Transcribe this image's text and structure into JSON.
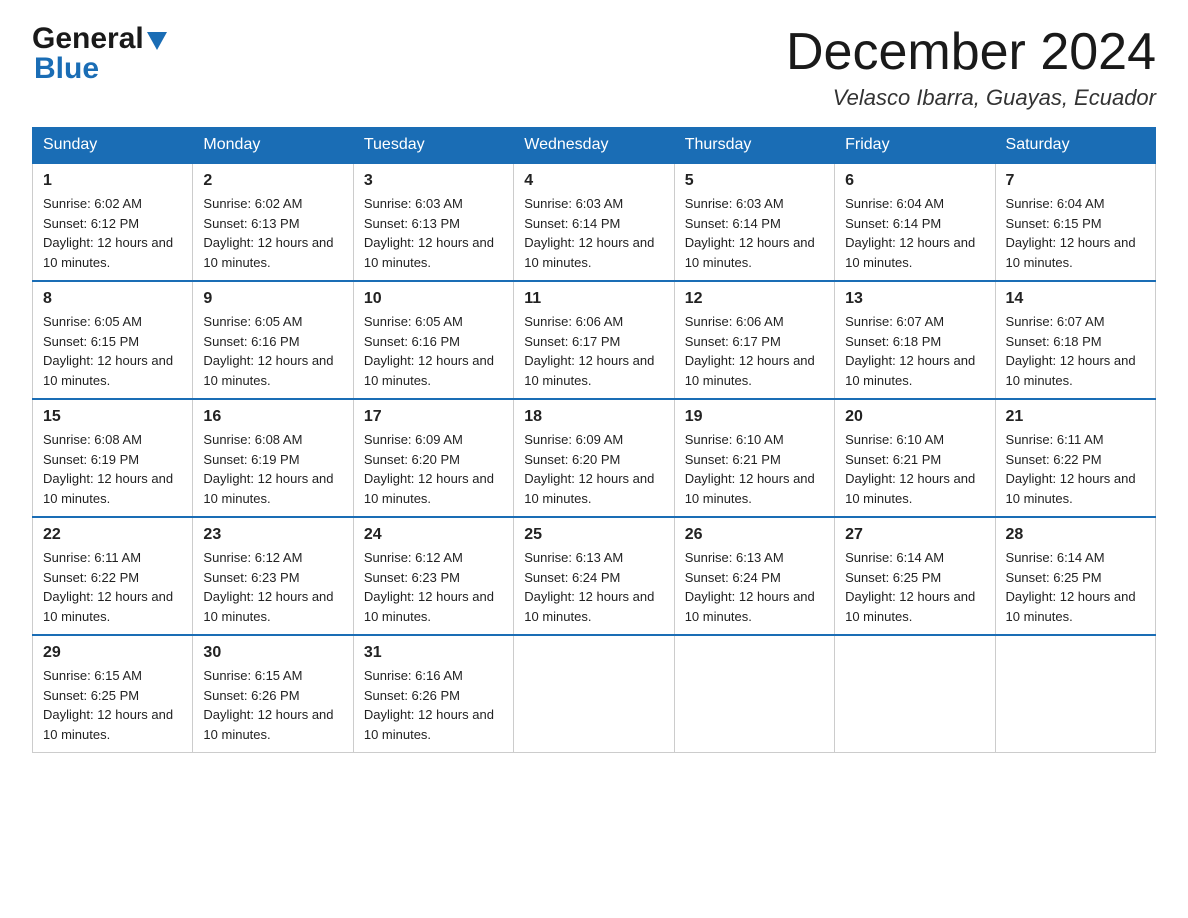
{
  "header": {
    "logo": {
      "general": "General",
      "blue": "Blue"
    },
    "title": "December 2024",
    "location": "Velasco Ibarra, Guayas, Ecuador"
  },
  "calendar": {
    "weekdays": [
      "Sunday",
      "Monday",
      "Tuesday",
      "Wednesday",
      "Thursday",
      "Friday",
      "Saturday"
    ],
    "weeks": [
      [
        {
          "day": "1",
          "sunrise": "Sunrise: 6:02 AM",
          "sunset": "Sunset: 6:12 PM",
          "daylight": "Daylight: 12 hours and 10 minutes."
        },
        {
          "day": "2",
          "sunrise": "Sunrise: 6:02 AM",
          "sunset": "Sunset: 6:13 PM",
          "daylight": "Daylight: 12 hours and 10 minutes."
        },
        {
          "day": "3",
          "sunrise": "Sunrise: 6:03 AM",
          "sunset": "Sunset: 6:13 PM",
          "daylight": "Daylight: 12 hours and 10 minutes."
        },
        {
          "day": "4",
          "sunrise": "Sunrise: 6:03 AM",
          "sunset": "Sunset: 6:14 PM",
          "daylight": "Daylight: 12 hours and 10 minutes."
        },
        {
          "day": "5",
          "sunrise": "Sunrise: 6:03 AM",
          "sunset": "Sunset: 6:14 PM",
          "daylight": "Daylight: 12 hours and 10 minutes."
        },
        {
          "day": "6",
          "sunrise": "Sunrise: 6:04 AM",
          "sunset": "Sunset: 6:14 PM",
          "daylight": "Daylight: 12 hours and 10 minutes."
        },
        {
          "day": "7",
          "sunrise": "Sunrise: 6:04 AM",
          "sunset": "Sunset: 6:15 PM",
          "daylight": "Daylight: 12 hours and 10 minutes."
        }
      ],
      [
        {
          "day": "8",
          "sunrise": "Sunrise: 6:05 AM",
          "sunset": "Sunset: 6:15 PM",
          "daylight": "Daylight: 12 hours and 10 minutes."
        },
        {
          "day": "9",
          "sunrise": "Sunrise: 6:05 AM",
          "sunset": "Sunset: 6:16 PM",
          "daylight": "Daylight: 12 hours and 10 minutes."
        },
        {
          "day": "10",
          "sunrise": "Sunrise: 6:05 AM",
          "sunset": "Sunset: 6:16 PM",
          "daylight": "Daylight: 12 hours and 10 minutes."
        },
        {
          "day": "11",
          "sunrise": "Sunrise: 6:06 AM",
          "sunset": "Sunset: 6:17 PM",
          "daylight": "Daylight: 12 hours and 10 minutes."
        },
        {
          "day": "12",
          "sunrise": "Sunrise: 6:06 AM",
          "sunset": "Sunset: 6:17 PM",
          "daylight": "Daylight: 12 hours and 10 minutes."
        },
        {
          "day": "13",
          "sunrise": "Sunrise: 6:07 AM",
          "sunset": "Sunset: 6:18 PM",
          "daylight": "Daylight: 12 hours and 10 minutes."
        },
        {
          "day": "14",
          "sunrise": "Sunrise: 6:07 AM",
          "sunset": "Sunset: 6:18 PM",
          "daylight": "Daylight: 12 hours and 10 minutes."
        }
      ],
      [
        {
          "day": "15",
          "sunrise": "Sunrise: 6:08 AM",
          "sunset": "Sunset: 6:19 PM",
          "daylight": "Daylight: 12 hours and 10 minutes."
        },
        {
          "day": "16",
          "sunrise": "Sunrise: 6:08 AM",
          "sunset": "Sunset: 6:19 PM",
          "daylight": "Daylight: 12 hours and 10 minutes."
        },
        {
          "day": "17",
          "sunrise": "Sunrise: 6:09 AM",
          "sunset": "Sunset: 6:20 PM",
          "daylight": "Daylight: 12 hours and 10 minutes."
        },
        {
          "day": "18",
          "sunrise": "Sunrise: 6:09 AM",
          "sunset": "Sunset: 6:20 PM",
          "daylight": "Daylight: 12 hours and 10 minutes."
        },
        {
          "day": "19",
          "sunrise": "Sunrise: 6:10 AM",
          "sunset": "Sunset: 6:21 PM",
          "daylight": "Daylight: 12 hours and 10 minutes."
        },
        {
          "day": "20",
          "sunrise": "Sunrise: 6:10 AM",
          "sunset": "Sunset: 6:21 PM",
          "daylight": "Daylight: 12 hours and 10 minutes."
        },
        {
          "day": "21",
          "sunrise": "Sunrise: 6:11 AM",
          "sunset": "Sunset: 6:22 PM",
          "daylight": "Daylight: 12 hours and 10 minutes."
        }
      ],
      [
        {
          "day": "22",
          "sunrise": "Sunrise: 6:11 AM",
          "sunset": "Sunset: 6:22 PM",
          "daylight": "Daylight: 12 hours and 10 minutes."
        },
        {
          "day": "23",
          "sunrise": "Sunrise: 6:12 AM",
          "sunset": "Sunset: 6:23 PM",
          "daylight": "Daylight: 12 hours and 10 minutes."
        },
        {
          "day": "24",
          "sunrise": "Sunrise: 6:12 AM",
          "sunset": "Sunset: 6:23 PM",
          "daylight": "Daylight: 12 hours and 10 minutes."
        },
        {
          "day": "25",
          "sunrise": "Sunrise: 6:13 AM",
          "sunset": "Sunset: 6:24 PM",
          "daylight": "Daylight: 12 hours and 10 minutes."
        },
        {
          "day": "26",
          "sunrise": "Sunrise: 6:13 AM",
          "sunset": "Sunset: 6:24 PM",
          "daylight": "Daylight: 12 hours and 10 minutes."
        },
        {
          "day": "27",
          "sunrise": "Sunrise: 6:14 AM",
          "sunset": "Sunset: 6:25 PM",
          "daylight": "Daylight: 12 hours and 10 minutes."
        },
        {
          "day": "28",
          "sunrise": "Sunrise: 6:14 AM",
          "sunset": "Sunset: 6:25 PM",
          "daylight": "Daylight: 12 hours and 10 minutes."
        }
      ],
      [
        {
          "day": "29",
          "sunrise": "Sunrise: 6:15 AM",
          "sunset": "Sunset: 6:25 PM",
          "daylight": "Daylight: 12 hours and 10 minutes."
        },
        {
          "day": "30",
          "sunrise": "Sunrise: 6:15 AM",
          "sunset": "Sunset: 6:26 PM",
          "daylight": "Daylight: 12 hours and 10 minutes."
        },
        {
          "day": "31",
          "sunrise": "Sunrise: 6:16 AM",
          "sunset": "Sunset: 6:26 PM",
          "daylight": "Daylight: 12 hours and 10 minutes."
        },
        null,
        null,
        null,
        null
      ]
    ]
  }
}
